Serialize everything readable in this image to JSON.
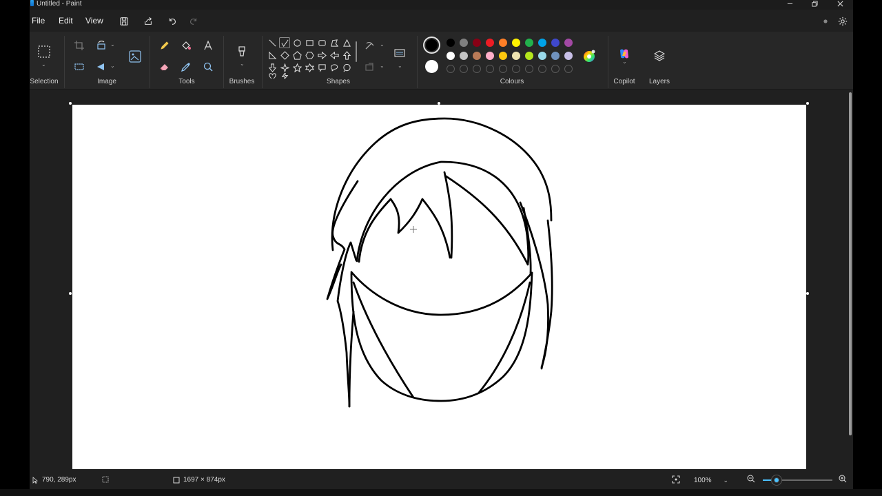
{
  "window": {
    "title": "Untitled - Paint",
    "minimize_icon": "minimize-icon",
    "restore_icon": "restore-icon",
    "close_icon": "close-icon"
  },
  "menu": {
    "file": "File",
    "edit": "Edit",
    "view": "View"
  },
  "quick_access": [
    "save-icon",
    "share-icon",
    "undo-icon",
    "redo-icon"
  ],
  "ribbon": {
    "groups": {
      "selection": "Selection",
      "image": "Image",
      "tools": "Tools",
      "brushes": "Brushes",
      "shapes": "Shapes",
      "colours": "Colours",
      "copilot": "Copilot",
      "layers": "Layers"
    },
    "colours": {
      "primary": "#000000",
      "secondary": "#ffffff",
      "row1": [
        "#000000",
        "#7f7f7f",
        "#880015",
        "#ed1c24",
        "#ff7f27",
        "#fff200",
        "#22b14c",
        "#00a2e8",
        "#3f48cc",
        "#a349a4"
      ],
      "row2": [
        "#ffffff",
        "#c3c3c3",
        "#b97a57",
        "#ffaec9",
        "#ffc90e",
        "#efe4b0",
        "#b5e61d",
        "#99d9ea",
        "#7092be",
        "#c8bfe7"
      ],
      "row3_empty_count": 10
    }
  },
  "status": {
    "cursor_position": "790, 289px",
    "canvas_size": "1697 × 874px",
    "zoom": "100%",
    "zoom_fraction": 0.2
  }
}
